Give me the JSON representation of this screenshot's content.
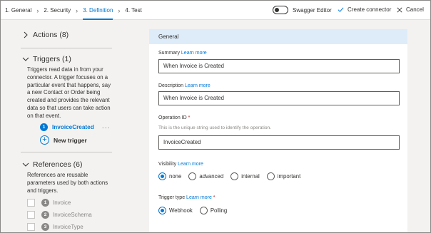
{
  "wizard": {
    "steps": [
      {
        "label": "1. General"
      },
      {
        "label": "2. Security"
      },
      {
        "label": "3. Definition"
      },
      {
        "label": "4. Test"
      }
    ],
    "active_step": 2
  },
  "toolbar": {
    "swagger_label": "Swagger Editor",
    "create_label": "Create connector",
    "cancel_label": "Cancel"
  },
  "left": {
    "actions": {
      "title": "Actions (8)"
    },
    "triggers": {
      "title": "Triggers (1)",
      "description": "Triggers read data in from your connector. A trigger focuses on a particular event that happens, say a new Contact or Order being created and provides the relevant data so that users can take action on that event.",
      "items": [
        {
          "num": "1",
          "name": "InvoiceCreated",
          "menu": "···"
        }
      ],
      "new_label": "New trigger"
    },
    "references": {
      "title": "References (6)",
      "description": "References are reusable parameters used by both actions and triggers.",
      "items": [
        {
          "num": "1",
          "name": "Invoice"
        },
        {
          "num": "2",
          "name": "InvoiceSchema"
        },
        {
          "num": "3",
          "name": "InvoiceType"
        }
      ]
    }
  },
  "form": {
    "section_title": "General",
    "summary": {
      "label": "Summary",
      "link": "Learn more",
      "value": "When Invoice is Created"
    },
    "description": {
      "label": "Description",
      "link": "Learn more",
      "value": "When Invoice is Created"
    },
    "operation_id": {
      "label": "Operation ID",
      "required": "*",
      "hint": "This is the unique string used to identify the operation.",
      "value": "InvoiceCreated"
    },
    "visibility": {
      "label": "Visibility",
      "link": "Learn more",
      "options": [
        "none",
        "advanced",
        "internal",
        "important"
      ],
      "selected": "none"
    },
    "trigger_type": {
      "label": "Trigger type",
      "link": "Learn more",
      "required": "*",
      "options": [
        "Webhook",
        "Polling"
      ],
      "selected": "Webhook"
    }
  },
  "colors": {
    "accent": "#0078d4",
    "header_band": "#deecf9",
    "background": "#f3f2f1"
  }
}
